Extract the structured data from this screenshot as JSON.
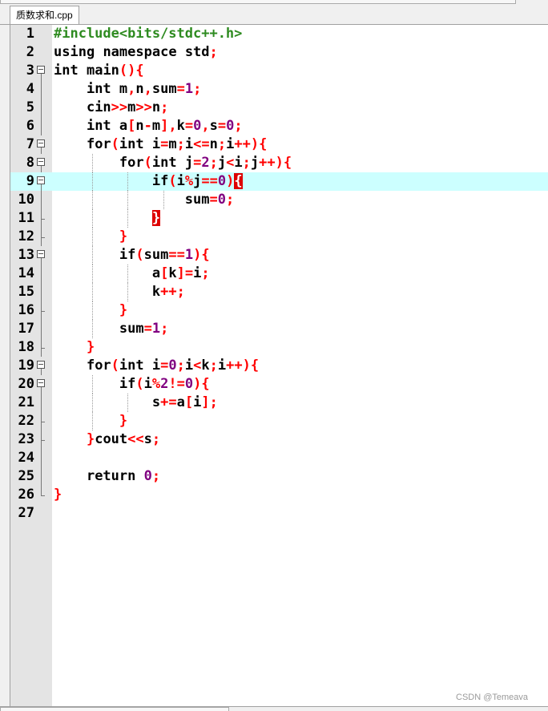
{
  "tab": {
    "label": "质数求和.cpp"
  },
  "watermark": "CSDN @Temeava",
  "current_line": 9,
  "lines": [
    {
      "n": "1",
      "fold": "",
      "guides": [],
      "code": "#include<bits/stdc++.h>"
    },
    {
      "n": "2",
      "fold": "",
      "guides": [],
      "code": "using namespace std;"
    },
    {
      "n": "3",
      "fold": "start",
      "guides": [],
      "code": "int main(){"
    },
    {
      "n": "4",
      "fold": "line",
      "guides": [],
      "code": "    int m,n,sum=1;"
    },
    {
      "n": "5",
      "fold": "line",
      "guides": [],
      "code": "    cin>>m>>n;"
    },
    {
      "n": "6",
      "fold": "line",
      "guides": [],
      "code": "    int a[n-m],k=0,s=0;"
    },
    {
      "n": "7",
      "fold": "start",
      "guides": [],
      "code": "    for(int i=m;i<=n;i++){"
    },
    {
      "n": "8",
      "fold": "start",
      "guides": [
        1
      ],
      "code": "        for(int j=2;j<i;j++){"
    },
    {
      "n": "9",
      "fold": "start",
      "guides": [
        1,
        2
      ],
      "code": "            if(i%j==0){"
    },
    {
      "n": "10",
      "fold": "line",
      "guides": [
        1,
        2,
        3
      ],
      "code": "                sum=0;"
    },
    {
      "n": "11",
      "fold": "end",
      "guides": [
        1,
        2
      ],
      "code": "            }"
    },
    {
      "n": "12",
      "fold": "end",
      "guides": [
        1
      ],
      "code": "        }"
    },
    {
      "n": "13",
      "fold": "start",
      "guides": [
        1
      ],
      "code": "        if(sum==1){"
    },
    {
      "n": "14",
      "fold": "line",
      "guides": [
        1,
        2
      ],
      "code": "            a[k]=i;"
    },
    {
      "n": "15",
      "fold": "line",
      "guides": [
        1,
        2
      ],
      "code": "            k++;"
    },
    {
      "n": "16",
      "fold": "end",
      "guides": [
        1
      ],
      "code": "        }"
    },
    {
      "n": "17",
      "fold": "line",
      "guides": [
        1
      ],
      "code": "        sum=1;"
    },
    {
      "n": "18",
      "fold": "end",
      "guides": [],
      "code": "    }"
    },
    {
      "n": "19",
      "fold": "start",
      "guides": [],
      "code": "    for(int i=0;i<k;i++){"
    },
    {
      "n": "20",
      "fold": "start",
      "guides": [
        1
      ],
      "code": "        if(i%2!=0){"
    },
    {
      "n": "21",
      "fold": "line",
      "guides": [
        1,
        2
      ],
      "code": "            s+=a[i];"
    },
    {
      "n": "22",
      "fold": "end",
      "guides": [
        1
      ],
      "code": "        }"
    },
    {
      "n": "23",
      "fold": "end",
      "guides": [],
      "code": "    }cout<<s;"
    },
    {
      "n": "24",
      "fold": "line",
      "guides": [],
      "code": ""
    },
    {
      "n": "25",
      "fold": "line",
      "guides": [],
      "code": "    return 0;"
    },
    {
      "n": "26",
      "fold": "end",
      "guides": [],
      "code": "}"
    },
    {
      "n": "27",
      "fold": "",
      "guides": [],
      "code": ""
    }
  ],
  "colors": {
    "preprocessor": "#2e8b20",
    "operator": "#ff0000",
    "number": "#800080",
    "current_line_bg": "#ccffff",
    "brace_match_bg": "#dd0000"
  }
}
